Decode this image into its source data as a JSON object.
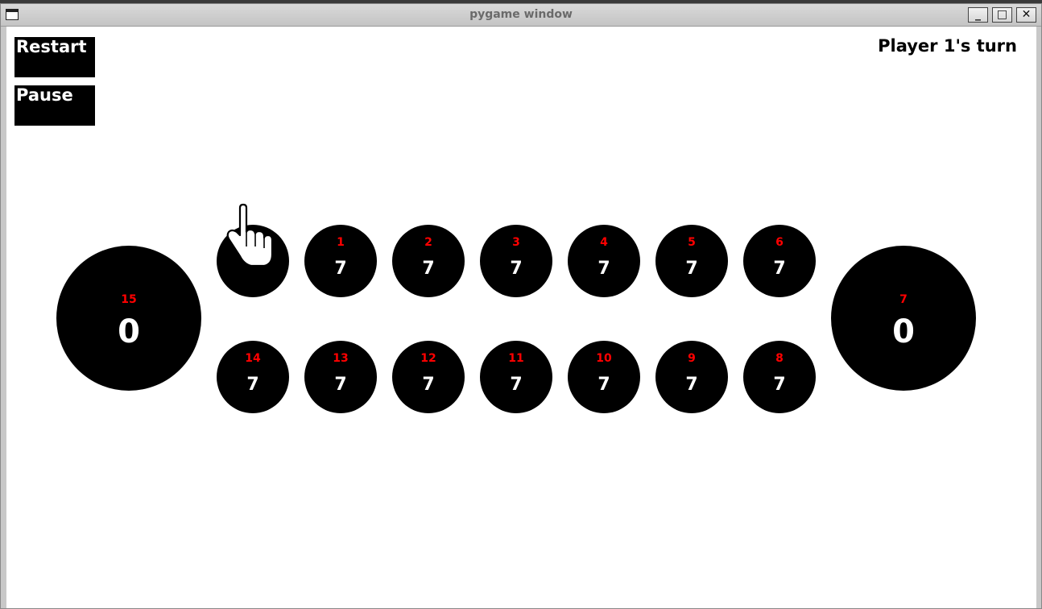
{
  "window": {
    "title": "pygame window",
    "controls": {
      "minimize": "_",
      "maximize": "□",
      "close": "✕"
    }
  },
  "game": {
    "restart_label": "Restart",
    "pause_label": "Pause",
    "turn_text": "Player 1's turn",
    "colors": {
      "pit": "#000000",
      "index": "#ff0000",
      "count": "#ffffff",
      "background": "#ffffff"
    },
    "stores": [
      {
        "index": "15",
        "count": "0"
      },
      {
        "index": "7",
        "count": "0"
      }
    ],
    "top_row": [
      {
        "index": "",
        "count": "0"
      },
      {
        "index": "1",
        "count": "7"
      },
      {
        "index": "2",
        "count": "7"
      },
      {
        "index": "3",
        "count": "7"
      },
      {
        "index": "4",
        "count": "7"
      },
      {
        "index": "5",
        "count": "7"
      },
      {
        "index": "6",
        "count": "7"
      }
    ],
    "bottom_row": [
      {
        "index": "14",
        "count": "7"
      },
      {
        "index": "13",
        "count": "7"
      },
      {
        "index": "12",
        "count": "7"
      },
      {
        "index": "11",
        "count": "7"
      },
      {
        "index": "10",
        "count": "7"
      },
      {
        "index": "9",
        "count": "7"
      },
      {
        "index": "8",
        "count": "7"
      }
    ],
    "cursor": "hand-pointer-icon"
  }
}
